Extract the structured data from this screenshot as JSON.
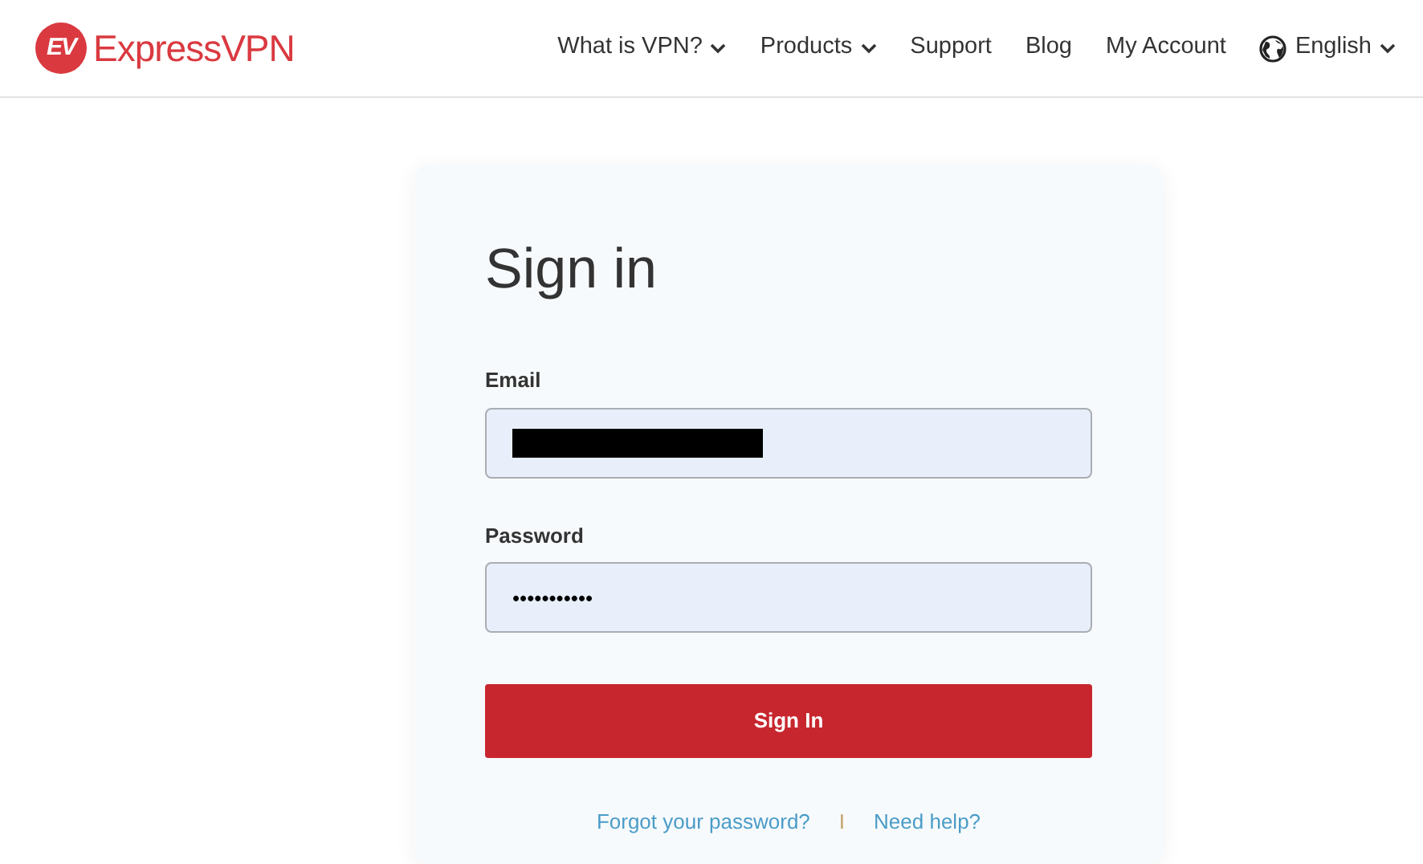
{
  "logo": {
    "mark": "EV",
    "name": "ExpressVPN"
  },
  "nav": [
    {
      "kind": "page",
      "label": "What is VPN?",
      "dropdown": true
    },
    {
      "kind": "page",
      "label": "Products",
      "dropdown": true
    },
    {
      "kind": "page",
      "label": "Support",
      "dropdown": false
    },
    {
      "kind": "page",
      "label": "Blog",
      "dropdown": false
    },
    {
      "kind": "page",
      "label": "My Account",
      "dropdown": false
    },
    {
      "kind": "language",
      "label": "English",
      "dropdown": true
    }
  ],
  "form": {
    "title": "Sign in",
    "fields": [
      {
        "label": "Email",
        "redacted": true
      },
      {
        "label": "Password",
        "value": "•••••••••••",
        "redacted": false
      }
    ],
    "submit": "Sign In",
    "links": [
      {
        "kind": "link",
        "label": "Forgot your password?"
      },
      {
        "kind": "separator",
        "label": "I"
      },
      {
        "kind": "link",
        "label": "Need help?"
      }
    ]
  }
}
